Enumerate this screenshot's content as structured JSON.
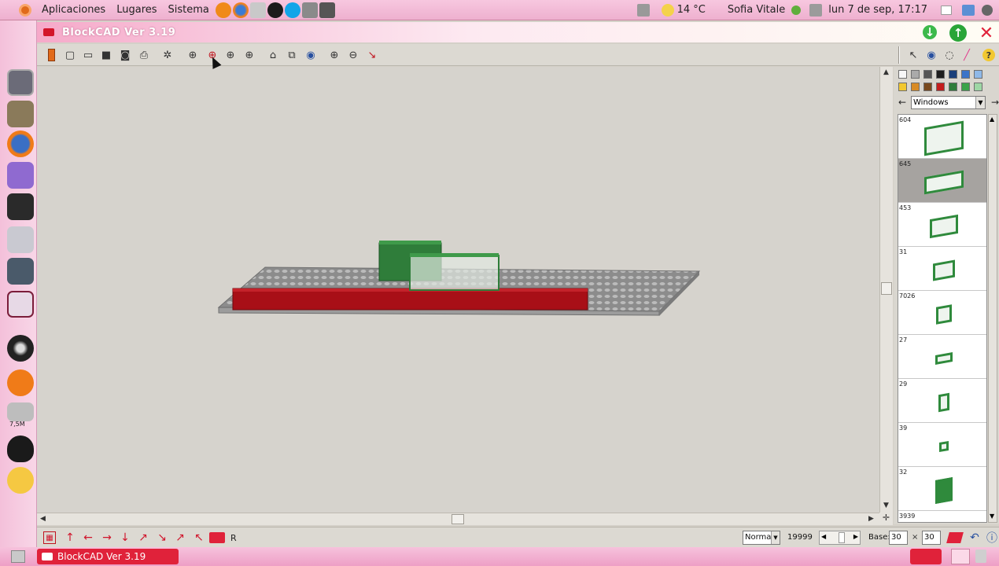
{
  "topbar": {
    "menus": [
      "Aplicaciones",
      "Lugares",
      "Sistema"
    ],
    "weather": "14 °C",
    "user": "Sofia Vitale",
    "datetime": "lun  7 de sep, 17:17"
  },
  "dock": {
    "trash_label": "7,5M"
  },
  "window": {
    "title": "BlockCAD Ver 3.19"
  },
  "toolbar": {
    "icons": [
      "brick-icon",
      "new-file-icon",
      "open-folder-icon",
      "save-icon",
      "camera-icon",
      "print-icon",
      "settings-icon",
      "rotate-left-icon",
      "rotate-up-icon",
      "rotate-down-icon",
      "rotate-right-icon",
      "view-3d-icon",
      "view-flip-icon",
      "eye-icon",
      "zoom-in-icon",
      "zoom-out-icon",
      "pointer-arrow-icon"
    ]
  },
  "palette": {
    "selected": "Windows",
    "colors": [
      "#f7f7f7",
      "#aaaaaa",
      "#555555",
      "#1e1e1e",
      "#1a3f7a",
      "#3b74c8",
      "#8fb9e8",
      "#f2c830",
      "#d88b25",
      "#7a4a1e",
      "#c41d1d",
      "#2f7d3a",
      "#3aa34a",
      "#9dd7a5"
    ]
  },
  "parts": [
    {
      "id": "604"
    },
    {
      "id": "645"
    },
    {
      "id": "453"
    },
    {
      "id": "31"
    },
    {
      "id": "7026"
    },
    {
      "id": "27"
    },
    {
      "id": "29"
    },
    {
      "id": "39"
    },
    {
      "id": "32"
    },
    {
      "id": "3939"
    }
  ],
  "status": {
    "r_label": "R",
    "mode": "Normal",
    "count": "19999",
    "base_label": "Base:",
    "base_x": "30",
    "times": "×",
    "base_y": "30"
  },
  "taskbar": {
    "window_label": "BlockCAD Ver 3.19"
  }
}
